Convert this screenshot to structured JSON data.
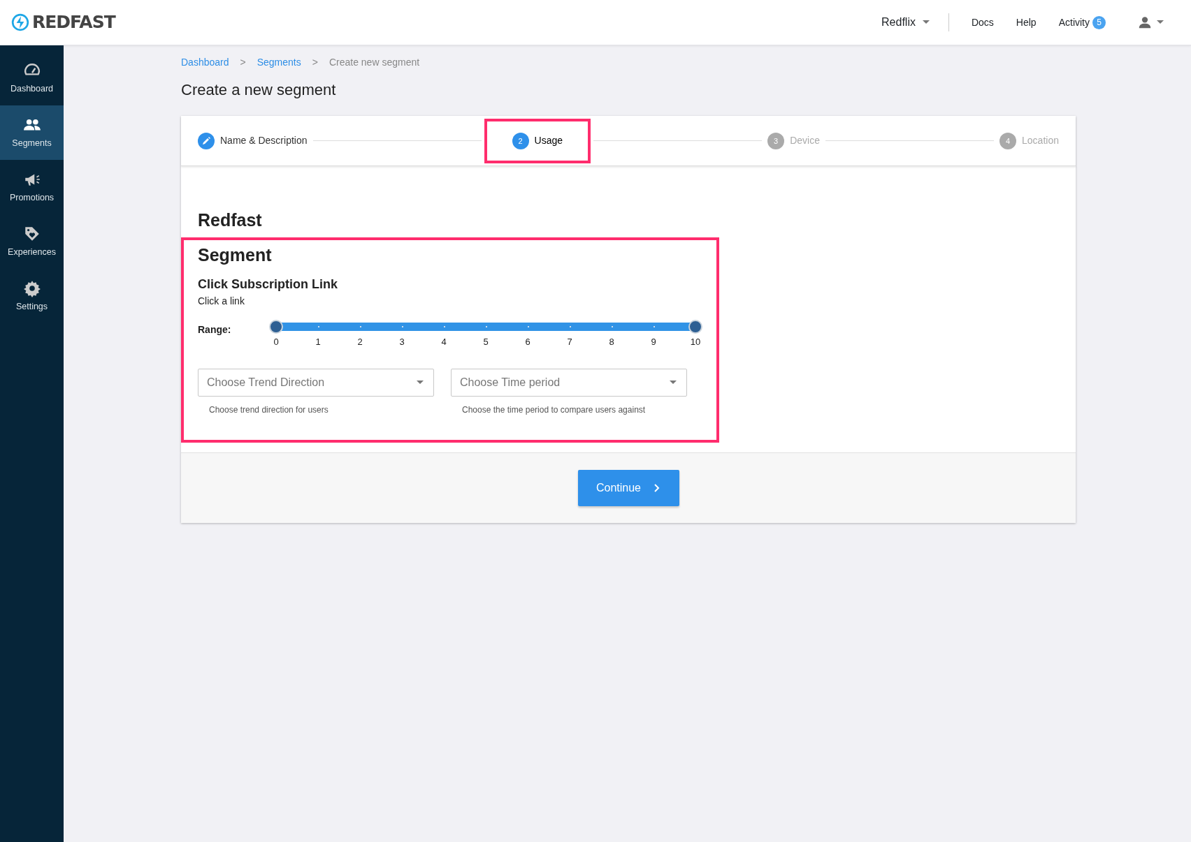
{
  "header": {
    "brand": "REDFAST",
    "account": "Redflix",
    "links": [
      "Docs",
      "Help"
    ],
    "activity": {
      "label": "Activity",
      "count": "5"
    }
  },
  "sidebar": {
    "items": [
      {
        "label": "Dashboard",
        "selected": false
      },
      {
        "label": "Segments",
        "selected": true
      },
      {
        "label": "Promotions",
        "selected": false
      },
      {
        "label": "Experiences",
        "selected": false
      },
      {
        "label": "Settings",
        "selected": false
      }
    ]
  },
  "breadcrumb": [
    {
      "label": "Dashboard",
      "link": true
    },
    {
      "label": "Segments",
      "link": true
    },
    {
      "label": "Create new segment",
      "link": false
    }
  ],
  "breadcrumb_separator": ">",
  "page_title": "Create a new segment",
  "steps": [
    {
      "label": "Name & Description",
      "completed": true,
      "selected": false,
      "disabled": false,
      "highlighted": false
    },
    {
      "number": "2",
      "label": "Usage",
      "completed": false,
      "selected": true,
      "disabled": false,
      "highlighted": true
    },
    {
      "number": "3",
      "label": "Device",
      "completed": false,
      "selected": false,
      "disabled": true,
      "highlighted": false
    },
    {
      "number": "4",
      "label": "Location",
      "completed": false,
      "selected": false,
      "disabled": true,
      "highlighted": false
    }
  ],
  "org_title": "Redfast",
  "segment": {
    "highlighted": true,
    "title": "Segment",
    "rule_title": "Click Subscription Link",
    "rule_description": "Click a link",
    "range": {
      "label": "Range:",
      "ticks": [
        "0",
        "1",
        "2",
        "3",
        "4",
        "5",
        "6",
        "7",
        "8",
        "9",
        "10"
      ],
      "thumbs": [
        {
          "level": 0
        },
        {
          "level": 1
        }
      ]
    },
    "selects": [
      {
        "placeholder": "Choose Trend Direction",
        "hint": "Choose trend direction for users"
      },
      {
        "placeholder": "Choose Time period",
        "hint": "Choose the time period to compare users against"
      }
    ]
  },
  "continue_button": "Continue"
}
